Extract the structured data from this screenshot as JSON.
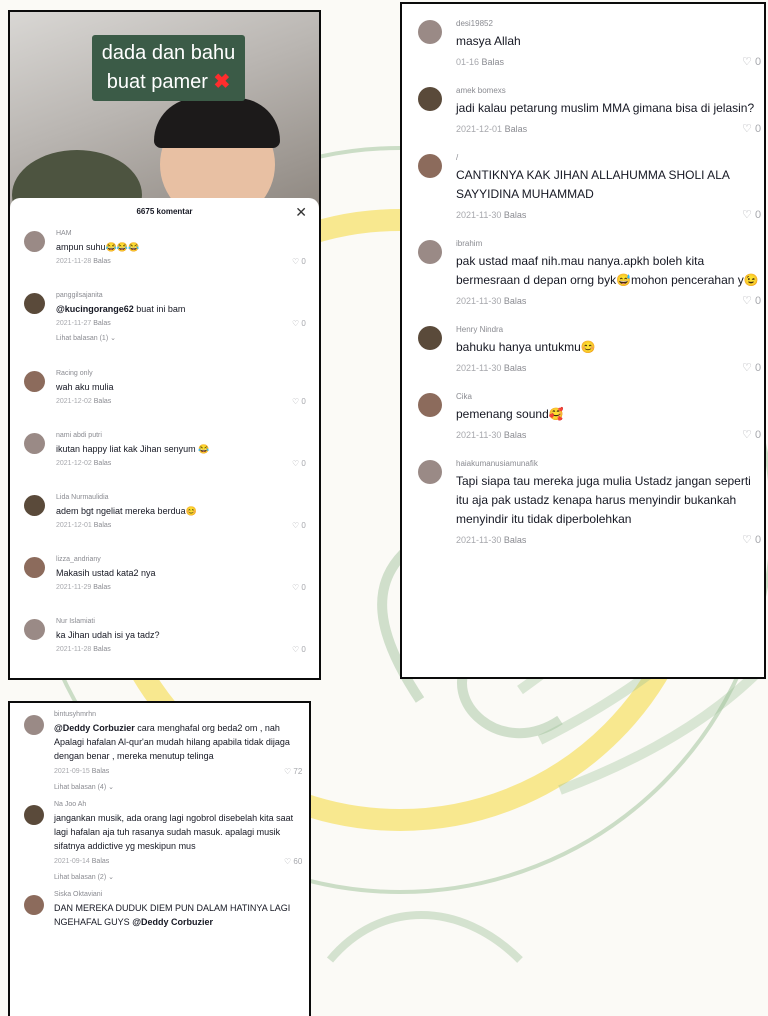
{
  "colors": {
    "accent_caption_bg": "#3b5b47",
    "cross_red": "#ff2d2d",
    "meta_gray": "#a7a8ad",
    "watermark_green": "#9bbf96",
    "watermark_yellow": "#f5d83a"
  },
  "video": {
    "caption_line1": "dada dan bahu",
    "caption_line2": "buat pamer",
    "caption_emoji": "✖"
  },
  "sheet": {
    "count_label": "6675 komentar",
    "close_icon": "✕"
  },
  "labels": {
    "reply": "Balas"
  },
  "panel1": [
    {
      "user": "HAM",
      "text": "ampun suhu😂😂😂",
      "date": "2021-11-28",
      "likes": "0"
    },
    {
      "user": "panggilsajanita",
      "mention": "@kucingorange62",
      "text": " buat ini bam",
      "date": "2021-11-27",
      "likes": "0",
      "replies": "Lihat balasan (1)"
    },
    {
      "user": "Racing only",
      "text": "wah aku mulia",
      "date": "2021-12-02",
      "likes": "0"
    },
    {
      "user": "nami abdi putri",
      "text": "ikutan happy liat kak Jihan senyum 😂",
      "date": "2021-12-02",
      "likes": "0"
    },
    {
      "user": "Lida Nurmaulidia",
      "text": "adem bgt ngeliat mereka berdua😊",
      "date": "2021-12-01",
      "likes": "0"
    },
    {
      "user": "lizza_andriany",
      "text": "Makasih ustad kata2 nya",
      "date": "2021-11-29",
      "likes": "0"
    },
    {
      "user": "Nur Islamiati",
      "text": "ka Jihan udah isi ya tadz?",
      "date": "2021-11-28",
      "likes": "0"
    }
  ],
  "panel2": [
    {
      "user": "desi19852",
      "text": "masya Allah",
      "date": "01-16",
      "likes": "0"
    },
    {
      "user": "amek bomexs",
      "text": "jadi kalau petarung muslim MMA gimana bisa di jelasin?",
      "date": "2021-12-01",
      "likes": "0"
    },
    {
      "user": "/",
      "text": "CANTIKNYA KAK JIHAN ALLAHUMMA SHOLI ALA SAYYIDINA MUHAMMAD",
      "date": "2021-11-30",
      "likes": "0"
    },
    {
      "user": "ibrahim",
      "text": "pak ustad maaf nih.mau nanya.apkh boleh kita bermesraan d depan orng byk😅mohon pencerahan y😉",
      "date": "2021-11-30",
      "likes": "0"
    },
    {
      "user": "Henry Nindra",
      "text": "bahuku hanya untukmu😊",
      "date": "2021-11-30",
      "likes": "0"
    },
    {
      "user": "Cika",
      "text": "pemenang sound🥰",
      "date": "2021-11-30",
      "likes": "0"
    },
    {
      "user": "haiakumanusiamunafik",
      "text": "Tapi siapa tau mereka juga mulia Ustadz jangan seperti itu aja pak ustadz kenapa harus menyindir bukankah menyindir itu tidak diperbolehkan",
      "date": "2021-11-30",
      "likes": "0"
    }
  ],
  "panel3": [
    {
      "user": "bintusyhmrhn",
      "mention": "@Deddy Corbuzier",
      "text": " cara menghafal org beda2 om , nah Apalagi hafalan Al-qur'an mudah hilang apabila tidak dijaga dengan benar , mereka menutup telinga",
      "date": "2021-09-15",
      "likes": "72",
      "replies": "Lihat balasan (4)"
    },
    {
      "user": "Na Joo Ah",
      "text": "jangankan musik, ada orang lagi ngobrol disebelah kita saat lagi hafalan aja tuh rasanya sudah masuk. apalagi musik sifatnya addictive yg meskipun mus",
      "date": "2021-09-14",
      "likes": "60",
      "replies": "Lihat balasan (2)"
    },
    {
      "user": "Siska Oktaviani",
      "text": "DAN MEREKA DUDUK DIEM PUN DALAM HATINYA LAGI NGEHAFAL GUYS ",
      "mention_after": "@Deddy Corbuzier",
      "date": "",
      "likes": ""
    }
  ]
}
